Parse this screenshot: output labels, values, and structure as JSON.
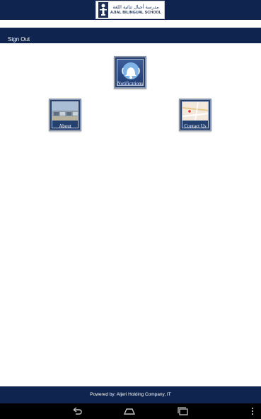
{
  "header": {
    "logo": {
      "arabic": "مدرسة أجيال ثنائية اللغة",
      "english": "AJIAL BILINGUAL SCHOOL"
    }
  },
  "toolbar": {
    "signout_label": "Sign Out"
  },
  "tiles": {
    "notifications": "Notifications",
    "about": "About",
    "contact": "Contact Us"
  },
  "footer": {
    "text": "Powered by: Aljeri Holding Company, IT"
  },
  "colors": {
    "brand_navy": "#0f2550",
    "tile_border": "#8b96ab",
    "nav_bar": "#000000"
  },
  "icons": {
    "notifications": "bell-icon",
    "about": "building-photo",
    "contact": "map-pin-icon",
    "back": "back-arrow-icon",
    "home": "home-icon",
    "recent": "recent-apps-icon",
    "menu": "overflow-menu-icon"
  }
}
